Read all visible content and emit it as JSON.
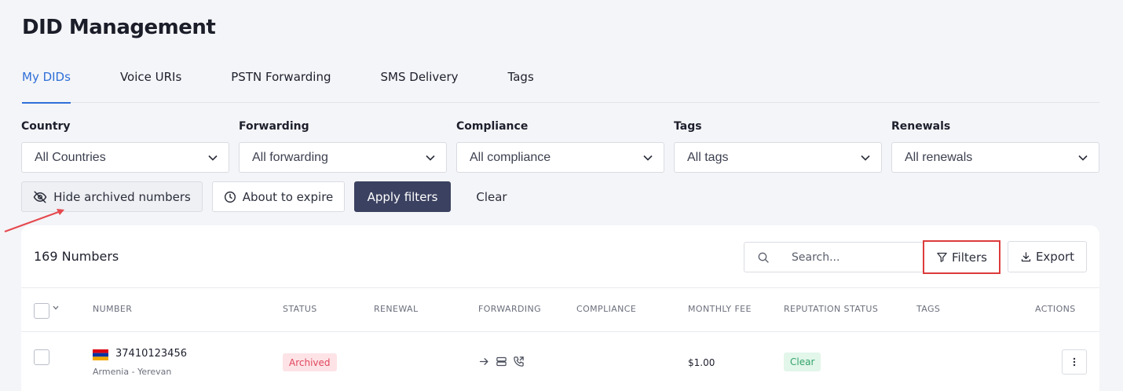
{
  "page_title": "DID Management",
  "tabs": [
    {
      "label": "My DIDs",
      "active": true
    },
    {
      "label": "Voice URIs",
      "active": false
    },
    {
      "label": "PSTN Forwarding",
      "active": false
    },
    {
      "label": "SMS Delivery",
      "active": false
    },
    {
      "label": "Tags",
      "active": false
    }
  ],
  "filters": {
    "country": {
      "label": "Country",
      "value": "All Countries"
    },
    "forwarding": {
      "label": "Forwarding",
      "value": "All forwarding"
    },
    "compliance": {
      "label": "Compliance",
      "value": "All compliance"
    },
    "tags": {
      "label": "Tags",
      "value": "All tags"
    },
    "renewals": {
      "label": "Renewals",
      "value": "All renewals"
    }
  },
  "actions": {
    "hide_archived": "Hide archived numbers",
    "about_to_expire": "About to expire",
    "apply": "Apply filters",
    "clear": "Clear"
  },
  "table": {
    "count_label": "169 Numbers",
    "search_placeholder": "Search...",
    "filters_label": "Filters",
    "export_label": "Export",
    "columns": [
      "NUMBER",
      "STATUS",
      "RENEWAL",
      "FORWARDING",
      "COMPLIANCE",
      "MONTHLY FEE",
      "REPUTATION STATUS",
      "TAGS",
      "ACTIONS"
    ],
    "rows": [
      {
        "number": "37410123456",
        "location": "Armenia - Yerevan",
        "status": "Archived",
        "renewal": "",
        "compliance": "",
        "monthly_fee": "$1.00",
        "reputation": "Clear",
        "tags": ""
      }
    ]
  },
  "colors": {
    "accent": "#2f6fd8",
    "primary_button": "#3b4160",
    "archived_bg": "#fde3e6",
    "archived_text": "#e0475e",
    "clear_bg": "#e2f6ea",
    "clear_text": "#34a46a",
    "highlight_border": "#dc3b3b"
  },
  "icons": [
    "eye-off-icon",
    "clock-icon",
    "search-icon",
    "funnel-icon",
    "download-icon",
    "chevron-down-icon",
    "arrow-right-icon",
    "server-icon",
    "phone-forward-icon",
    "more-vertical-icon",
    "armenia-flag-icon"
  ]
}
